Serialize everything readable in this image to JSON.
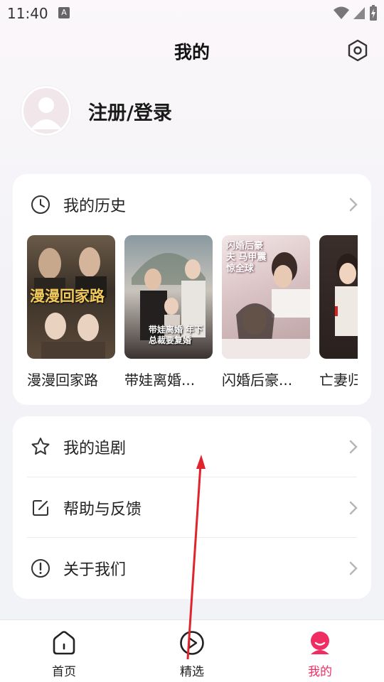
{
  "status_bar": {
    "time": "11:40",
    "notif_icon": "A"
  },
  "header": {
    "title": "我的"
  },
  "profile": {
    "login_label": "注册/登录"
  },
  "history": {
    "title": "我的历史",
    "items": [
      {
        "title": "漫漫回家路",
        "poster_text": "漫漫回家路"
      },
      {
        "title": "带娃离婚...",
        "poster_text": "带娃离婚 年下总裁要复婚"
      },
      {
        "title": "闪婚后豪...",
        "poster_text": "闪婚后豪夫 马甲震惊全球"
      },
      {
        "title": "亡妻归"
      }
    ]
  },
  "menu": {
    "items": [
      {
        "label": "我的追剧",
        "icon": "star-icon"
      },
      {
        "label": "帮助与反馈",
        "icon": "edit-icon"
      },
      {
        "label": "关于我们",
        "icon": "info-icon"
      }
    ]
  },
  "tabbar": {
    "tabs": [
      {
        "label": "首页",
        "icon": "home-icon"
      },
      {
        "label": "精选",
        "icon": "play-icon"
      },
      {
        "label": "我的",
        "icon": "profile-icon",
        "active": true
      }
    ]
  },
  "colors": {
    "accent": "#f02d62",
    "annotation_arrow": "#e0242b"
  }
}
